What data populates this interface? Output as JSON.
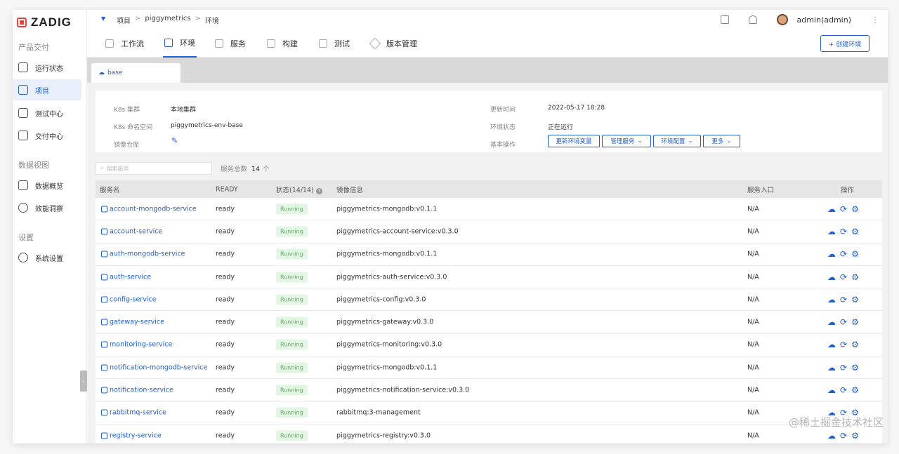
{
  "brand": {
    "name": "ZADIG",
    "color": "#e8433b"
  },
  "accent": "#1f5fd0",
  "sidebar": {
    "groups": [
      {
        "title": "产品交付",
        "items": [
          {
            "label": "运行状态",
            "icon": "activity-icon"
          },
          {
            "label": "项目",
            "icon": "project-icon",
            "active": true
          },
          {
            "label": "测试中心",
            "icon": "flask-icon"
          },
          {
            "label": "交付中心",
            "icon": "delivery-icon"
          }
        ]
      },
      {
        "title": "数据视图",
        "items": [
          {
            "label": "数据概览",
            "icon": "chart-icon"
          },
          {
            "label": "效能洞察",
            "icon": "pie-icon"
          }
        ]
      },
      {
        "title": "设置",
        "items": [
          {
            "label": "系统设置",
            "icon": "gear-icon"
          }
        ]
      }
    ]
  },
  "breadcrumb": {
    "items": [
      "项目",
      "piggymetrics",
      "环境"
    ],
    "sep": ">"
  },
  "user": {
    "name": "admin(admin)"
  },
  "tabs": [
    {
      "label": "工作流"
    },
    {
      "label": "环境",
      "active": true
    },
    {
      "label": "服务"
    },
    {
      "label": "构建"
    },
    {
      "label": "测试"
    },
    {
      "label": "版本管理"
    }
  ],
  "create_env_label": "+ 创建环境",
  "env_tab": {
    "name": "base"
  },
  "info": {
    "k8s_cluster_label": "K8s 集群",
    "k8s_cluster": "本地集群",
    "namespace_label": "K8s 命名空间",
    "namespace": "piggymetrics-env-base",
    "registry_label": "镜像仓库",
    "update_time_label": "更新时间",
    "update_time": "2022-05-17 18:28",
    "env_status_label": "环境状态",
    "env_status": "正在运行",
    "basic_ops_label": "基本操作",
    "ops": [
      "更新环境变量",
      "管理服务",
      "环境配置",
      "更多"
    ]
  },
  "search": {
    "placeholder": "搜索服务"
  },
  "total": {
    "label": "服务总数",
    "count": "14",
    "unit": "个"
  },
  "table": {
    "headers": [
      "服务名",
      "READY",
      "状态(14/14)",
      "镜像信息",
      "服务入口",
      "操作"
    ],
    "rows": [
      {
        "name": "account-mongodb-service",
        "ready": "ready",
        "status": "Running",
        "image": "piggymetrics-mongodb:v0.1.1",
        "entry": "N/A"
      },
      {
        "name": "account-service",
        "ready": "ready",
        "status": "Running",
        "image": "piggymetrics-account-service:v0.3.0",
        "entry": "N/A"
      },
      {
        "name": "auth-mongodb-service",
        "ready": "ready",
        "status": "Running",
        "image": "piggymetrics-mongodb:v0.1.1",
        "entry": "N/A"
      },
      {
        "name": "auth-service",
        "ready": "ready",
        "status": "Running",
        "image": "piggymetrics-auth-service:v0.3.0",
        "entry": "N/A"
      },
      {
        "name": "config-service",
        "ready": "ready",
        "status": "Running",
        "image": "piggymetrics-config:v0.3.0",
        "entry": "N/A"
      },
      {
        "name": "gateway-service",
        "ready": "ready",
        "status": "Running",
        "image": "piggymetrics-gateway:v0.3.0",
        "entry": "N/A"
      },
      {
        "name": "monitoring-service",
        "ready": "ready",
        "status": "Running",
        "image": "piggymetrics-monitoring:v0.3.0",
        "entry": "N/A"
      },
      {
        "name": "notification-mongodb-service",
        "ready": "ready",
        "status": "Running",
        "image": "piggymetrics-mongodb:v0.1.1",
        "entry": "N/A"
      },
      {
        "name": "notification-service",
        "ready": "ready",
        "status": "Running",
        "image": "piggymetrics-notification-service:v0.3.0",
        "entry": "N/A"
      },
      {
        "name": "rabbitmq-service",
        "ready": "ready",
        "status": "Running",
        "image": "rabbitmq:3-management",
        "entry": "N/A"
      },
      {
        "name": "registry-service",
        "ready": "ready",
        "status": "Running",
        "image": "piggymetrics-registry:v0.3.0",
        "entry": "N/A"
      }
    ]
  },
  "watermark": "@稀土掘金技术社区"
}
